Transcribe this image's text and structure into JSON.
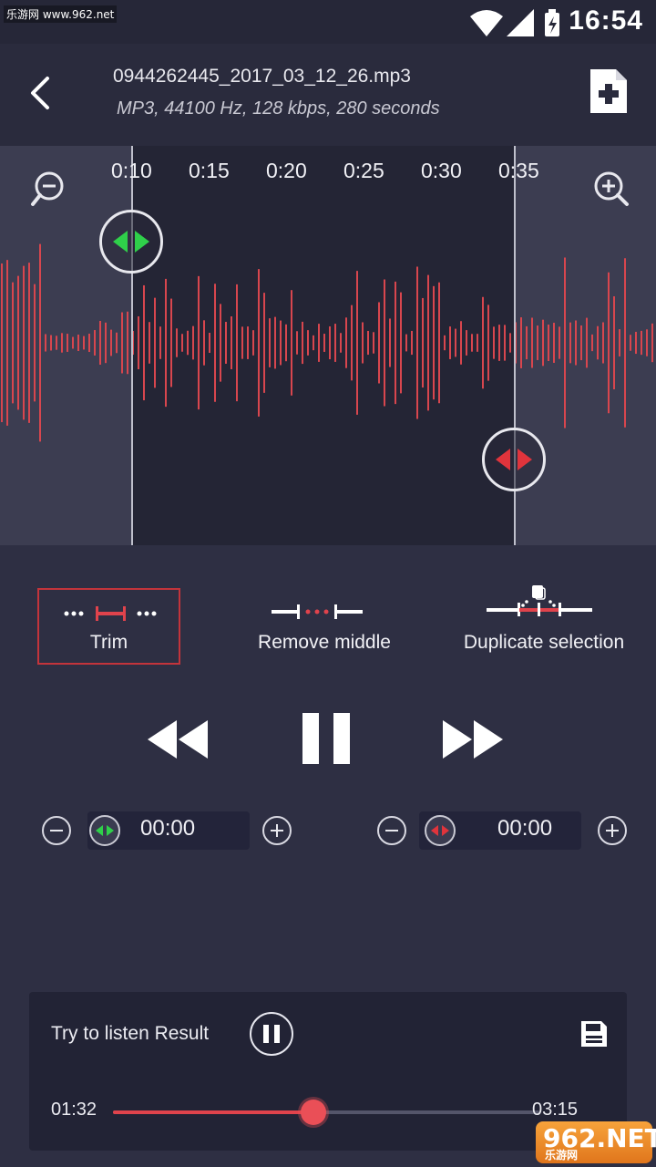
{
  "watermark": {
    "top_text": "乐游网 www.962.net",
    "brand_big": "962.NET",
    "brand_small": "乐游网"
  },
  "status": {
    "time": "16:54"
  },
  "header": {
    "file_name": "0944262445_2017_03_12_26.mp3",
    "file_meta": "MP3, 44100 Hz, 128 kbps, 280 seconds"
  },
  "timeline": {
    "ticks": [
      "0:10",
      "0:15",
      "0:20",
      "0:25",
      "0:30",
      "0:35"
    ]
  },
  "tools": {
    "trim": "Trim",
    "remove_middle": "Remove middle",
    "duplicate": "Duplicate selection",
    "selected": "trim"
  },
  "start_time": {
    "value": "00:00"
  },
  "end_time": {
    "value": "00:00"
  },
  "result": {
    "label": "Try to listen Result",
    "elapsed": "01:32",
    "total": "03:15",
    "progress": 0.47
  },
  "colors": {
    "accent": "#e0434c",
    "start_handle": "#2fd04a",
    "end_handle": "#e0343c",
    "background": "#2e2f43"
  },
  "icons": [
    "back-arrow-icon",
    "new-file-icon",
    "zoom-out-icon",
    "zoom-in-icon",
    "rewind-icon",
    "pause-icon",
    "fast-forward-icon",
    "save-icon"
  ]
}
